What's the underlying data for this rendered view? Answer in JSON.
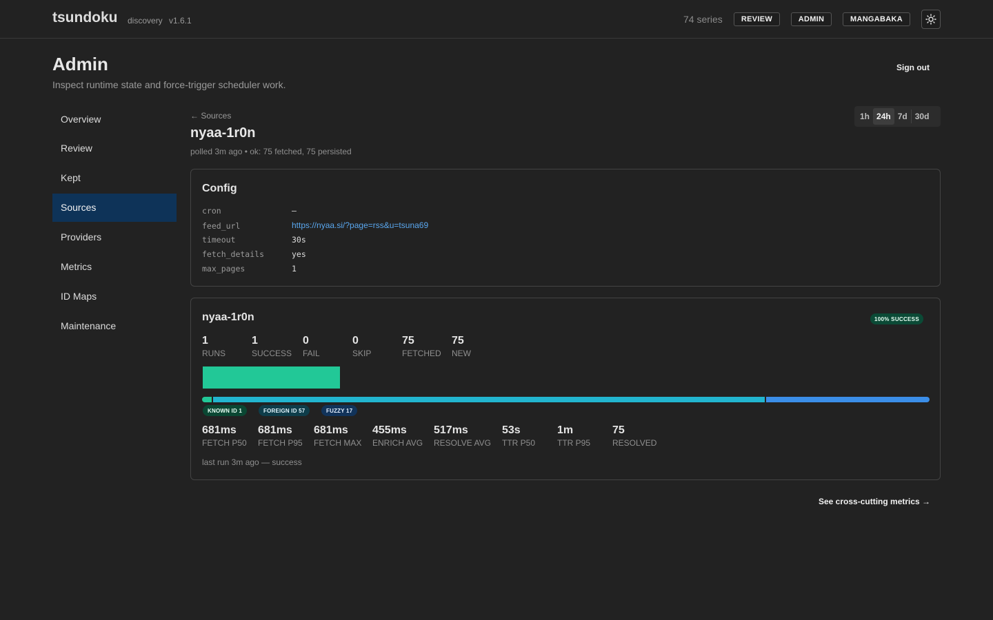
{
  "header": {
    "brand": "tsundoku",
    "subtitle": "discovery",
    "version": "v1.6.1",
    "series_count": "74 series",
    "nav": [
      "REVIEW",
      "ADMIN",
      "MANGABAKA"
    ],
    "theme_icon": "sun-icon"
  },
  "page": {
    "title": "Admin",
    "subtitle": "Inspect runtime state and force-trigger scheduler work.",
    "sign_out": "Sign out"
  },
  "sidebar": {
    "items": [
      "Overview",
      "Review",
      "Kept",
      "Sources",
      "Providers",
      "Metrics",
      "ID Maps",
      "Maintenance"
    ],
    "active": "Sources"
  },
  "source": {
    "back": "← Sources",
    "name": "nyaa-1r0n",
    "status": "polled 3m ago  • ok: 75 fetched, 75 persisted"
  },
  "time_range": {
    "options": [
      "1h",
      "24h",
      "7d",
      "30d"
    ],
    "selected": "24h"
  },
  "config": {
    "title": "Config",
    "rows": [
      {
        "key": "cron",
        "value": "—"
      },
      {
        "key": "feed_url",
        "value": "https://nyaa.si/?page=rss&u=tsuna69"
      },
      {
        "key": "timeout",
        "value": "30s"
      },
      {
        "key": "fetch_details",
        "value": "yes"
      },
      {
        "key": "max_pages",
        "value": "1"
      }
    ]
  },
  "stats": {
    "title": "nyaa-1r0n",
    "badge": "100% SUCCESS",
    "counts": [
      {
        "value": "1",
        "label": "RUNS"
      },
      {
        "value": "1",
        "label": "SUCCESS"
      },
      {
        "value": "0",
        "label": "FAIL"
      },
      {
        "value": "0",
        "label": "SKIP"
      },
      {
        "value": "75",
        "label": "FETCHED"
      },
      {
        "value": "75",
        "label": "NEW"
      }
    ],
    "resolution_split": [
      {
        "name": "KNOWN ID",
        "count": 1,
        "color": "#22c897"
      },
      {
        "name": "FOREIGN ID",
        "count": 57,
        "color": "#22b5cf"
      },
      {
        "name": "FUZZY",
        "count": 17,
        "color": "#3b8ee8"
      }
    ],
    "pills": [
      "KNOWN ID 1",
      "FOREIGN ID 57",
      "FUZZY 17"
    ],
    "timings": [
      {
        "value": "681ms",
        "label": "FETCH P50"
      },
      {
        "value": "681ms",
        "label": "FETCH P95"
      },
      {
        "value": "681ms",
        "label": "FETCH MAX"
      },
      {
        "value": "455ms",
        "label": "ENRICH AVG"
      },
      {
        "value": "517ms",
        "label": "RESOLVE AVG"
      },
      {
        "value": "53s",
        "label": "TTR P50"
      },
      {
        "value": "1m",
        "label": "TTR P95"
      },
      {
        "value": "75",
        "label": "RESOLVED"
      }
    ],
    "last_run": "last run 3m ago — success"
  },
  "footer": {
    "link": "See cross-cutting metrics →"
  }
}
